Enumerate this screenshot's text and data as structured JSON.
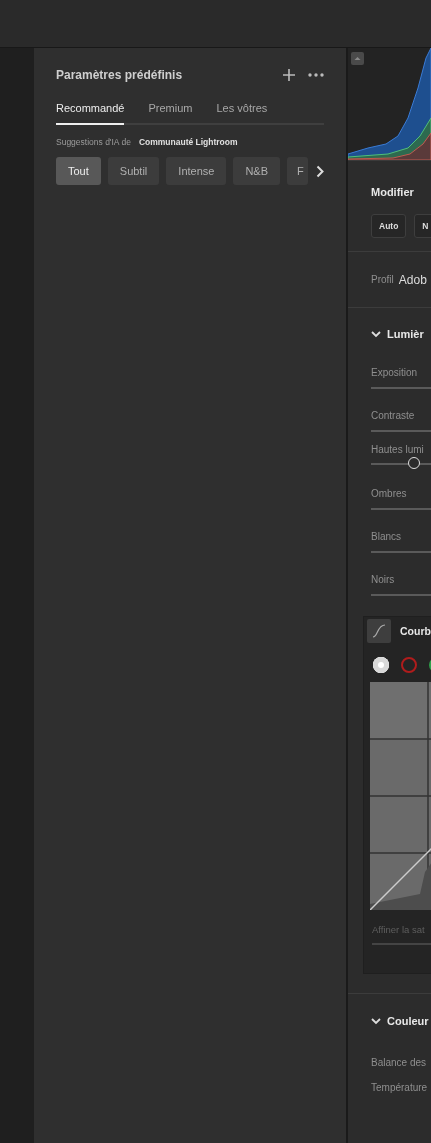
{
  "presets": {
    "title": "Paramètres prédéfinis",
    "tabs": [
      {
        "label": "Recommandé",
        "selected": true
      },
      {
        "label": "Premium",
        "selected": false
      },
      {
        "label": "Les vôtres",
        "selected": false
      }
    ],
    "suggestion_label": "Suggestions d'IA de",
    "suggestion_source": "Communauté Lightroom",
    "filters": [
      {
        "label": "Tout",
        "selected": true
      },
      {
        "label": "Subtil",
        "selected": false
      },
      {
        "label": "Intense",
        "selected": false
      },
      {
        "label": "N&B",
        "selected": false
      },
      {
        "label": "F",
        "selected": false
      }
    ]
  },
  "edit": {
    "title": "Modifier",
    "buttons": [
      "Auto",
      "N"
    ],
    "profile_label": "Profil",
    "profile_value": "Adob",
    "light": {
      "title": "Lumièr",
      "expanded": true,
      "sliders": [
        {
          "label": "Exposition"
        },
        {
          "label": "Contraste"
        },
        {
          "label": "Hautes lumi",
          "level": 0.19
        },
        {
          "label": "Ombres"
        },
        {
          "label": "Blancs"
        },
        {
          "label": "Noirs"
        }
      ]
    },
    "curve": {
      "title": "Courb",
      "channels": [
        {
          "color": "#d8d8d8",
          "selected": true
        },
        {
          "color": "#b01c1c",
          "selected": false
        },
        {
          "color": "#2ea04a",
          "selected": false
        }
      ],
      "refine_label": "Affiner la sat"
    },
    "color": {
      "title": "Couleur",
      "expanded": true,
      "rows": [
        "Balance des",
        "Température"
      ]
    }
  }
}
